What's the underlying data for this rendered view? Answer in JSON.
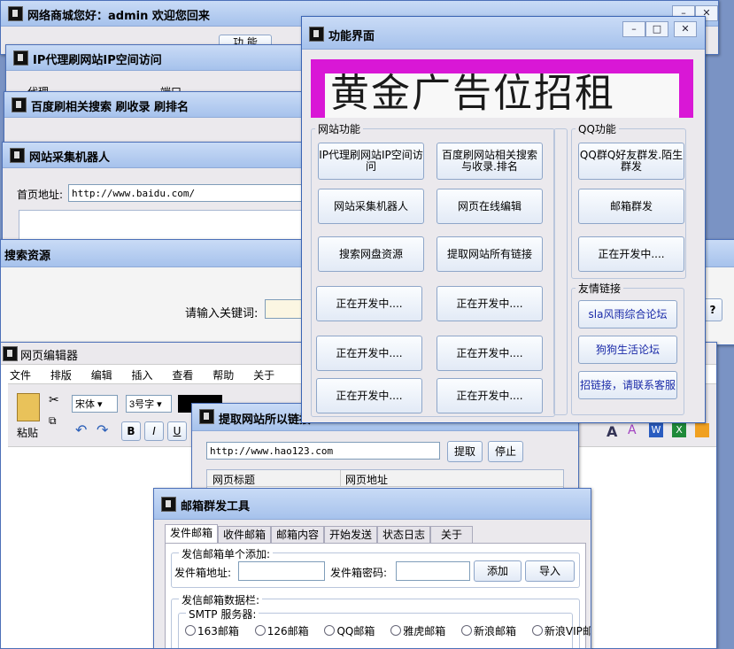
{
  "w_shop": {
    "title": "网络商城您好：admin 欢迎您回来",
    "tab_func": "功 能"
  },
  "w_proxy": {
    "title": "IP代理刷网站IP空间访问",
    "col1": "代理",
    "col2": "端口"
  },
  "w_baidu": {
    "title": "百度刷相关搜索 刷收录 刷排名"
  },
  "w_crawler": {
    "title": "网站采集机器人",
    "home_label": "首页地址:",
    "home_value": "http://www.baidu.com/"
  },
  "w_search": {
    "title": "搜索资源",
    "keyword_label": "请输入关键词:",
    "help_btn": "?"
  },
  "w_editor": {
    "title": "网页编辑器",
    "menu": [
      "文件",
      "排版",
      "编辑",
      "插入",
      "查看",
      "帮助",
      "关于"
    ],
    "paste_label": "粘贴",
    "font_name": "宋体",
    "font_size": "3号字",
    "bold": "B",
    "italic": "I",
    "underline": "U"
  },
  "w_links": {
    "title": "提取网站所以链接",
    "url_value": "http://www.hao123.com",
    "extract_btn": "提取",
    "stop_btn": "停止",
    "col_title": "网页标题",
    "col_url": "网页地址"
  },
  "w_func": {
    "title": "功能界面",
    "banner": "黄金广告位招租",
    "site_group": "网站功能",
    "qq_group": "QQ功能",
    "friend_group": "友情链接",
    "site_buttons": [
      "IP代理刷网站IP空间访问",
      "百度刷网站相关搜索与收录.排名",
      "网站采集机器人",
      "网页在线编辑",
      "搜索网盘资源",
      "提取网站所有链接",
      "正在开发中....",
      "正在开发中....",
      "正在开发中....",
      "正在开发中....",
      "正在开发中....",
      "正在开发中...."
    ],
    "qq_buttons": [
      "QQ群Q好友群发.陌生群发",
      "邮箱群发",
      "正在开发中...."
    ],
    "friend_buttons": [
      "sla风雨综合论坛",
      "狗狗生活论坛",
      "招链接，请联系客服"
    ]
  },
  "w_mail": {
    "title": "邮箱群发工具",
    "tabs": [
      "发件邮箱",
      "收件邮箱",
      "邮箱内容",
      "开始发送",
      "状态日志",
      "关于"
    ],
    "single_group": "发信邮箱单个添加:",
    "addr_label": "发件箱地址:",
    "pwd_label": "发件箱密码:",
    "add_btn": "添加",
    "import_btn": "导入",
    "data_group": "发信邮箱数据栏:",
    "smtp_group": "SMTP 服务器:",
    "smtp_options": [
      "163邮箱",
      "126邮箱",
      "QQ邮箱",
      "雅虎邮箱",
      "新浪邮箱",
      "新浪VIP邮箱"
    ]
  },
  "window_buttons": {
    "minimize": "–",
    "maximize": "□",
    "close": "✕"
  },
  "colors": {
    "titlebar": "#b7cef1",
    "banner_bg": "#d917d6",
    "banner_text": "#1a1a1a",
    "link_text": "#1a2aa8"
  }
}
